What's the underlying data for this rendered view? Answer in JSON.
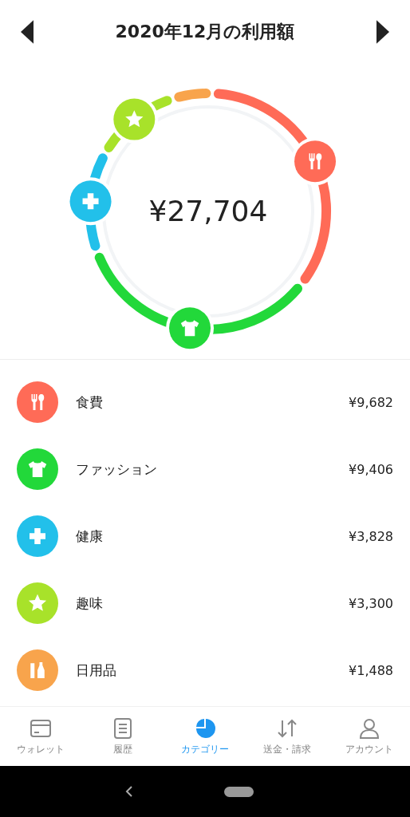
{
  "header": {
    "title": "2020年12月の利用額"
  },
  "total": "¥27,704",
  "categories": [
    {
      "kind": "food",
      "name": "食費",
      "amount": "¥9,682",
      "color": "#ff6b57"
    },
    {
      "kind": "fashion",
      "name": "ファッション",
      "amount": "¥9,406",
      "color": "#22d83a"
    },
    {
      "kind": "health",
      "name": "健康",
      "amount": "¥3,828",
      "color": "#22c0ea"
    },
    {
      "kind": "hobby",
      "name": "趣味",
      "amount": "¥3,300",
      "color": "#a8e22a"
    },
    {
      "kind": "daily",
      "name": "日用品",
      "amount": "¥1,488",
      "color": "#f8a44c"
    }
  ],
  "nav": [
    {
      "kind": "wallet",
      "label": "ウォレット",
      "selected": false
    },
    {
      "kind": "history",
      "label": "履歴",
      "selected": false
    },
    {
      "kind": "category",
      "label": "カテゴリー",
      "selected": true
    },
    {
      "kind": "transfer",
      "label": "送金・請求",
      "selected": false
    },
    {
      "kind": "account",
      "label": "アカウント",
      "selected": false
    }
  ]
}
